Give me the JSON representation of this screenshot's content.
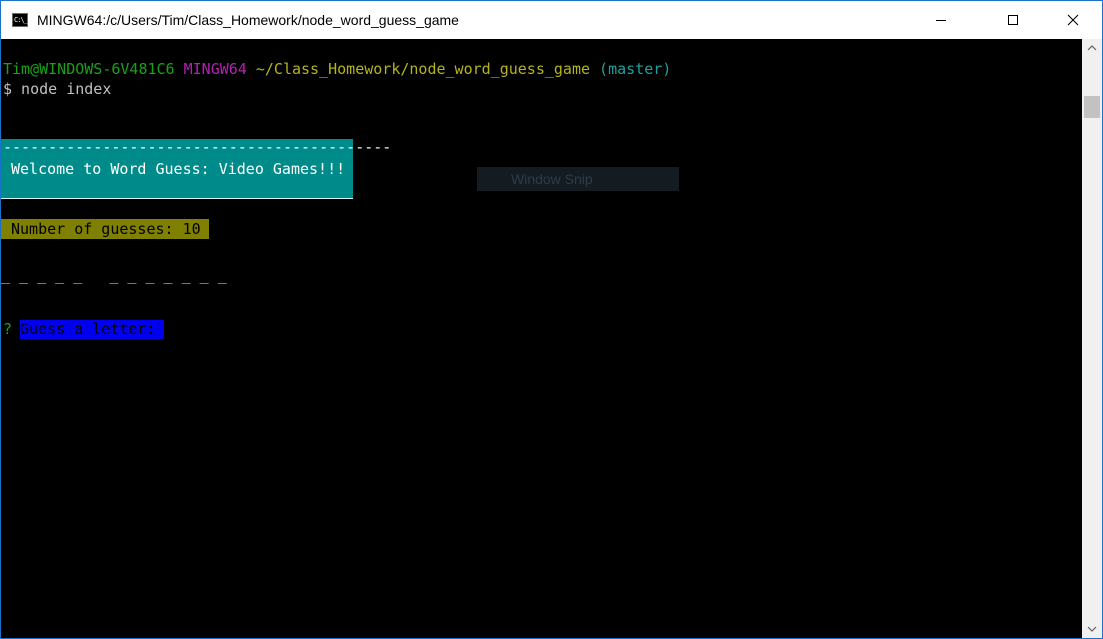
{
  "window": {
    "title": "MINGW64:/c/Users/Tim/Class_Homework/node_word_guess_game",
    "icon": "terminal-icon",
    "icon_glyph": "C:\\_",
    "buttons": [
      "minimize-icon",
      "maximize-icon",
      "close-icon"
    ]
  },
  "terminal": {
    "prompt": {
      "user_host": "Tim@WINDOWS-6V481C6",
      "shell": "MINGW64",
      "path": "~/Class_Homework/node_word_guess_game",
      "branch": "(master)"
    },
    "command": "$ node index",
    "banner": {
      "dashes": "-------------------------------------------",
      "message": "Welcome to Word Guess: Video Games!!!"
    },
    "guesses": "Number of guesses: 10",
    "word_blanks": "_ _ _ _ _   _ _ _ _ _ _ _",
    "question_mark": "?",
    "question": "Guess a letter: "
  },
  "overlay": {
    "label": "Window Snip"
  },
  "colors": {
    "terminal_bg": "#000000",
    "green": "#1aa01a",
    "magenta": "#b420b4",
    "yellow": "#b4b41c",
    "cyan": "#1ea0a0",
    "banner_bg": "#008b8b",
    "guesses_bg": "#808000",
    "question_bg": "#0000ee"
  }
}
